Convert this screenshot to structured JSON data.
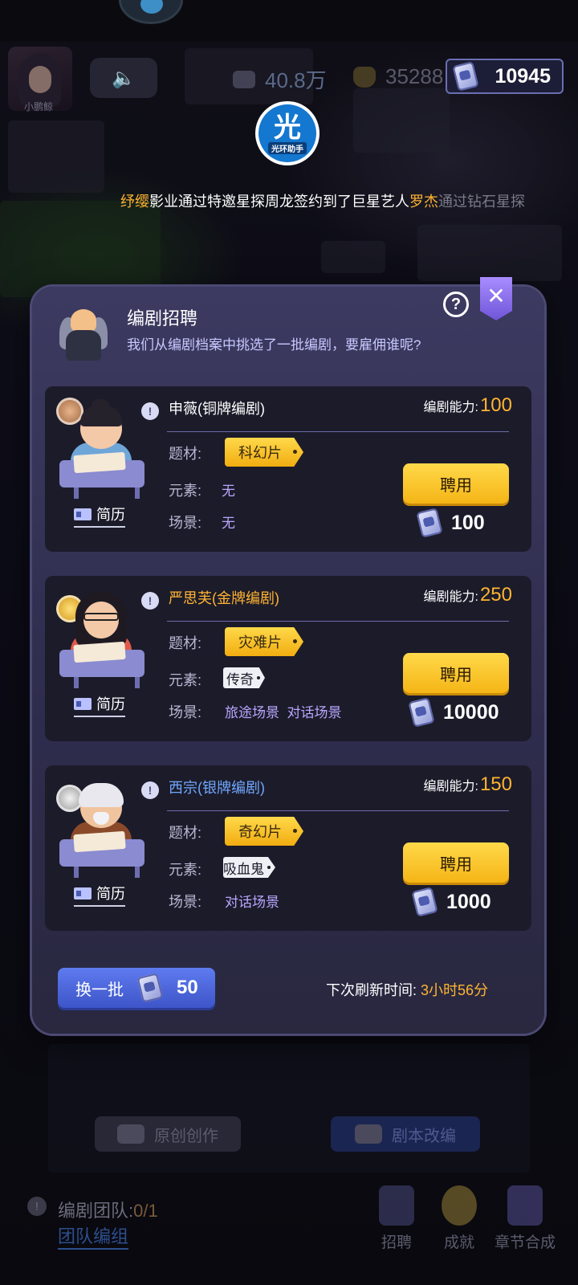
{
  "hud": {
    "avatar_name": "小鹏鲸",
    "money": "40.8万",
    "coins": "35288",
    "gems": "10945"
  },
  "logo": {
    "big": "光",
    "small": "光环助手"
  },
  "ticker": {
    "company": "纾缨",
    "text1": "影业通过特邀星探周龙签约到了巨星艺人",
    "star": "罗杰",
    "trail": "通过钻石星探"
  },
  "modal": {
    "title": "编剧招聘",
    "subtitle": "我们从编剧档案中挑选了一批编剧，要雇佣谁呢?",
    "help": "?",
    "close": "✕"
  },
  "labels": {
    "ability": "编剧能力:",
    "genre": "题材:",
    "element": "元素:",
    "scene": "场景:",
    "resume": "简历",
    "hire": "聘用",
    "info": "!"
  },
  "writers": [
    {
      "name": "申薇(铜牌编剧)",
      "rank": "bronze",
      "ability": "100",
      "genre": "科幻片",
      "element": "无",
      "scene": "无",
      "cost": "100"
    },
    {
      "name": "严思芙(金牌编剧)",
      "rank": "gold",
      "ability": "250",
      "genre": "灾难片",
      "element": "传奇",
      "scene": "旅途场景  对话场景",
      "cost": "10000"
    },
    {
      "name": "西宗(银牌编剧)",
      "rank": "silver",
      "ability": "150",
      "genre": "奇幻片",
      "element": "吸血鬼",
      "scene": "对话场景",
      "cost": "1000"
    }
  ],
  "refresh": {
    "label": "换一批",
    "cost": "50",
    "next_label": "下次刷新时间:",
    "next_time": "3小时56分"
  },
  "bottom": {
    "btn_create": "原创创作",
    "btn_adapt": "剧本改编",
    "team_label": "编剧团队:",
    "team_count": "0/1",
    "team_link": "团队编组",
    "nav_recruit": "招聘",
    "nav_achievement": "成就",
    "nav_merge": "章节合成"
  },
  "colors": {
    "accent_gold": "#ffb431",
    "silver_name": "#6fa8ff",
    "hire_button": "#f5b516",
    "refresh_button": "#3d55c8",
    "modal_bg": "#34325a"
  }
}
